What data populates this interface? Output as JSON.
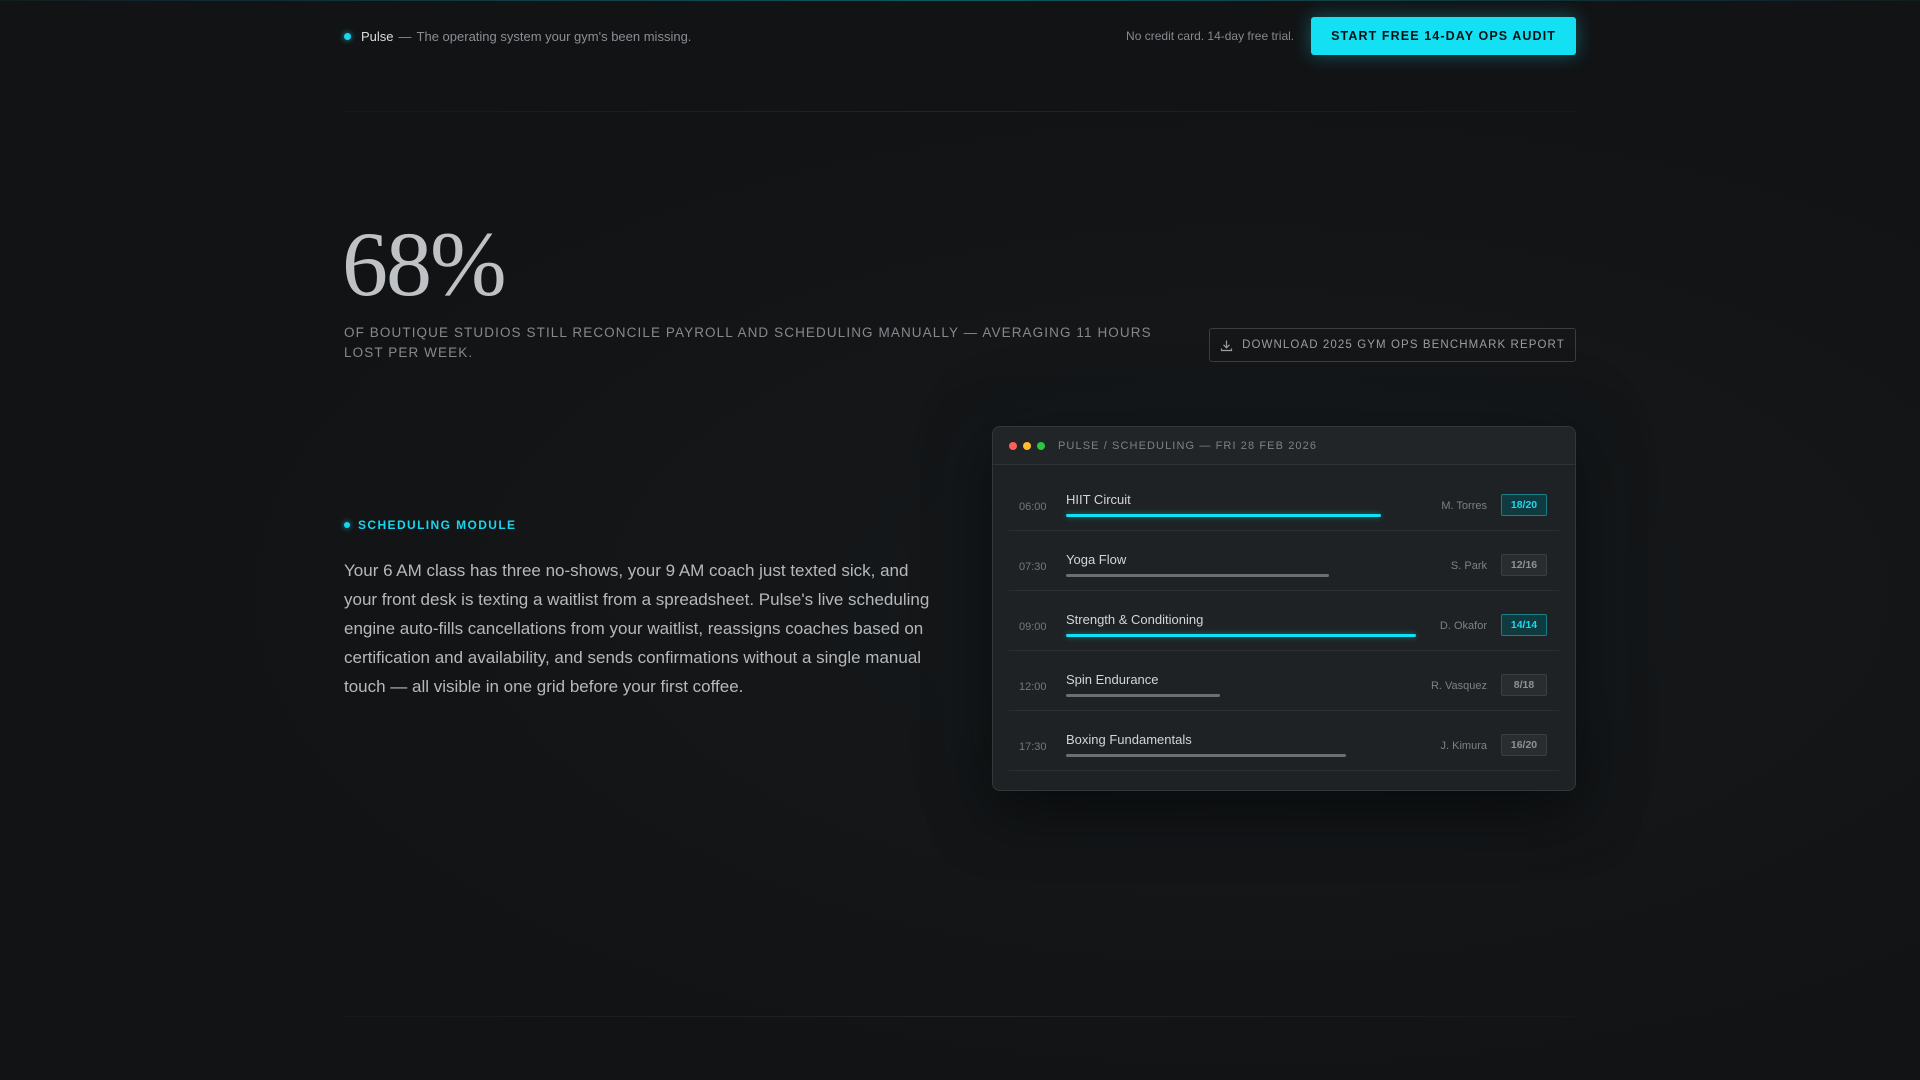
{
  "nav": {
    "brand": "Pulse",
    "separator": "—",
    "tagline": "The operating system your gym's been missing.",
    "trial_note": "No credit card. 14-day free trial.",
    "cta_label": "START FREE 14-DAY OPS AUDIT"
  },
  "stat": {
    "number": "68%",
    "caption": "OF BOUTIQUE STUDIOS STILL RECONCILE PAYROLL AND SCHEDULING MANUALLY — AVERAGING 11 HOURS LOST PER WEEK.",
    "report_button_label": "DOWNLOAD 2025 GYM OPS BENCHMARK REPORT",
    "report_icon": "download-icon"
  },
  "module": {
    "label": "SCHEDULING MODULE",
    "body": "Your 6 AM class has three no-shows, your 9 AM coach just texted sick, and your front desk is texting a waitlist from a spreadsheet. Pulse's live scheduling engine auto-fills cancellations from your waitlist, reassigns coaches based on certification and availability, and sends confirmations without a single manual touch — all visible in one grid before your first coffee."
  },
  "window": {
    "title": "PULSE / SCHEDULING — FRI 28 FEB 2026",
    "classes": [
      {
        "time": "06:00",
        "name": "HIIT Circuit",
        "coach": "M. Torres",
        "capacity": "18/20",
        "fill": 0.9,
        "highlight": true
      },
      {
        "time": "07:30",
        "name": "Yoga Flow",
        "coach": "S. Park",
        "capacity": "12/16",
        "fill": 0.75,
        "highlight": false
      },
      {
        "time": "09:00",
        "name": "Strength & Conditioning",
        "coach": "D. Okafor",
        "capacity": "14/14",
        "fill": 1.0,
        "highlight": true
      },
      {
        "time": "12:00",
        "name": "Spin Endurance",
        "coach": "R. Vasquez",
        "capacity": "8/18",
        "fill": 0.44,
        "highlight": false
      },
      {
        "time": "17:30",
        "name": "Boxing Fundamentals",
        "coach": "J. Kimura",
        "capacity": "16/20",
        "fill": 0.8,
        "highlight": false
      }
    ]
  },
  "colors": {
    "accent": "#14e0f3",
    "background": "#121315",
    "bar_muted": "#6b6f74"
  }
}
